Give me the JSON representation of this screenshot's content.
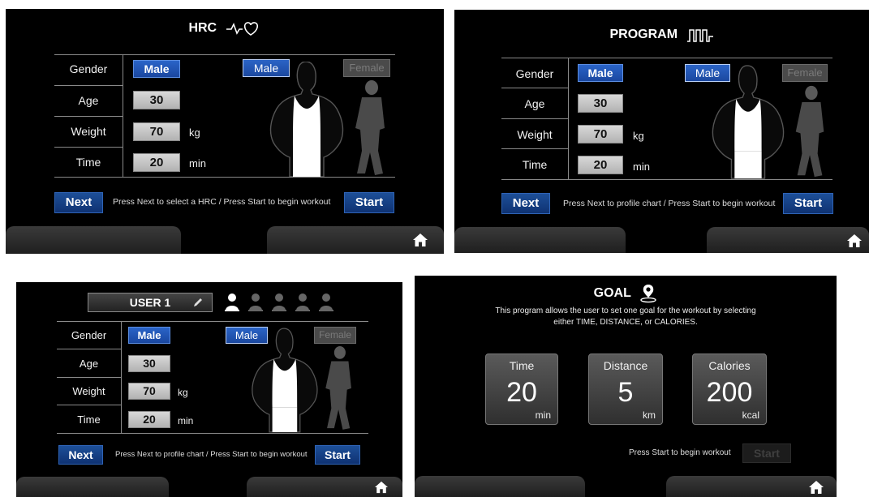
{
  "hrc": {
    "title": "HRC",
    "rows": [
      {
        "label": "Gender",
        "value": "Male",
        "unit": ""
      },
      {
        "label": "Age",
        "value": "30",
        "unit": ""
      },
      {
        "label": "Weight",
        "value": "70",
        "unit": "kg"
      },
      {
        "label": "Time",
        "value": "20",
        "unit": "min"
      }
    ],
    "male_button": "Male",
    "female_button": "Female",
    "next_label": "Next",
    "start_label": "Start",
    "hint": "Press Next to select a HRC  /  Press Start to begin workout"
  },
  "program": {
    "title": "PROGRAM",
    "rows": [
      {
        "label": "Gender",
        "value": "Male",
        "unit": ""
      },
      {
        "label": "Age",
        "value": "30",
        "unit": ""
      },
      {
        "label": "Weight",
        "value": "70",
        "unit": "kg"
      },
      {
        "label": "Time",
        "value": "20",
        "unit": "min"
      }
    ],
    "male_button": "Male",
    "female_button": "Female",
    "next_label": "Next",
    "start_label": "Start",
    "hint": "Press Next to profile chart  /  Press Start to begin workout"
  },
  "user": {
    "user_name": "USER 1",
    "rows": [
      {
        "label": "Gender",
        "value": "Male",
        "unit": ""
      },
      {
        "label": "Age",
        "value": "30",
        "unit": ""
      },
      {
        "label": "Weight",
        "value": "70",
        "unit": "kg"
      },
      {
        "label": "Time",
        "value": "20",
        "unit": "min"
      }
    ],
    "male_button": "Male",
    "female_button": "Female",
    "next_label": "Next",
    "start_label": "Start",
    "hint": "Press Next to profile chart  /  Press Start to begin workout"
  },
  "goal": {
    "title": "GOAL",
    "description_line1": "This program allows the user to set one goal for the workout by selecting",
    "description_line2": "either TIME, DISTANCE, or CALORIES.",
    "cards": [
      {
        "label": "Time",
        "value": "20",
        "unit": "min"
      },
      {
        "label": "Distance",
        "value": "5",
        "unit": "km"
      },
      {
        "label": "Calories",
        "value": "200",
        "unit": "kcal"
      }
    ],
    "hint": "Press Start to begin workout",
    "start_label": "Start"
  },
  "colors": {
    "accent_blue": "#1a47a0",
    "panel_bg": "#000000",
    "value_box": "#c4c4c4"
  },
  "icons": [
    "heart-rate-icon",
    "program-profile-icon",
    "pencil-icon",
    "user-profile-icon",
    "map-pin-icon",
    "home-icon"
  ]
}
